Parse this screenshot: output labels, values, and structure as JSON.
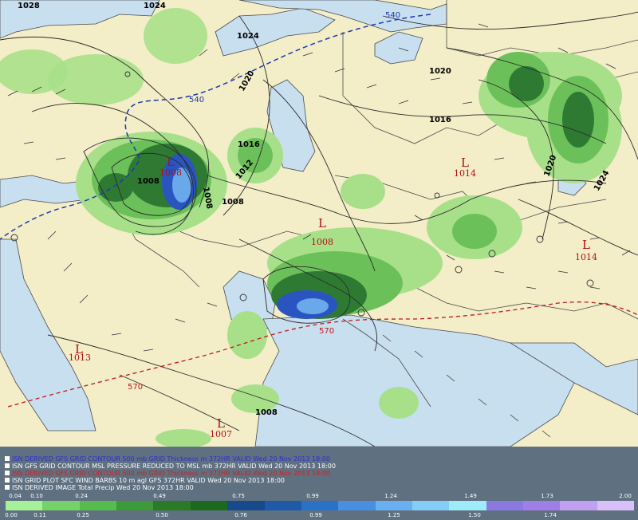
{
  "map": {
    "isobar_labels": [
      "1028",
      "1024",
      "1024",
      "1020",
      "1020",
      "1016",
      "1016",
      "1012",
      "1008",
      "1008",
      "1008",
      "1008",
      "1020",
      "1024"
    ],
    "thickness_labels": {
      "blue": [
        "540",
        "540"
      ],
      "red": [
        "570",
        "570"
      ]
    },
    "lows": [
      {
        "symbol": "L",
        "pressure": "1008"
      },
      {
        "symbol": "L",
        "pressure": "1014"
      },
      {
        "symbol": "L",
        "pressure": "1008"
      },
      {
        "symbol": "L",
        "pressure": "1014"
      },
      {
        "symbol": "L",
        "pressure": "1013"
      },
      {
        "symbol": "L",
        "pressure": "1007"
      }
    ],
    "colors": {
      "land": "#f3edc8",
      "water": "#c8dff0",
      "precip_light": "#a8e08a",
      "precip_mid": "#6cc05a",
      "precip_dark": "#2f7a32",
      "precip_blue": "#2a55c0",
      "precip_light_blue": "#6aa8ec",
      "line_540": "#1c3ab0",
      "line_570": "#c01818"
    }
  },
  "legend": {
    "lines": [
      {
        "text": "ISN DERIVED GFS GRID CONTOUR 500 mb GRID Thickness m 372HR VALID Wed 20 Nov 2013 18:00",
        "color": "#2a30d0"
      },
      {
        "text": "ISN GFS GRID CONTOUR MSL PRESSURE REDUCED TO MSL mb 372HR VALID Wed 20 Nov 2013 18:00",
        "color": "#ffffff"
      },
      {
        "text": "ISN DERIVED GFS GRID CONTOUR 500 mb GRID Thickness m 372HR VALID Wed 20 Nov 2013 18:00",
        "color": "#d02020"
      },
      {
        "text": "ISN GRID PLOT SFC WIND BARBS 10 m agl GFS 372HR VALID Wed 20 Nov 2013 18:00",
        "color": "#ffffff"
      },
      {
        "text": "ISN DERIVED IMAGE Total Precip Wed 20 Nov 2013 18:00",
        "color": "#ffffff"
      }
    ],
    "scale_colors": [
      "#a6f09a",
      "#74d268",
      "#56bc4e",
      "#3c9a38",
      "#2a7a28",
      "#1c6a20",
      "#164a8a",
      "#1e5aa8",
      "#2a72c8",
      "#4a8ee0",
      "#6ab0f0",
      "#86ccf8",
      "#9eecfa",
      "#8a7ae0",
      "#a07ee8",
      "#c0a0f0",
      "#d8c0f8"
    ],
    "scale_top_labels": [
      "0.04",
      "0.10",
      "0.24",
      "0.49",
      "0.75",
      "0.99",
      "1.24",
      "1.49",
      "1.73",
      "2.00"
    ],
    "scale_bottom_labels": [
      "0.00",
      "0.11",
      "0.25",
      "0.50",
      "0.76",
      "0.99",
      "1.25",
      "1.50",
      "1.74"
    ]
  }
}
